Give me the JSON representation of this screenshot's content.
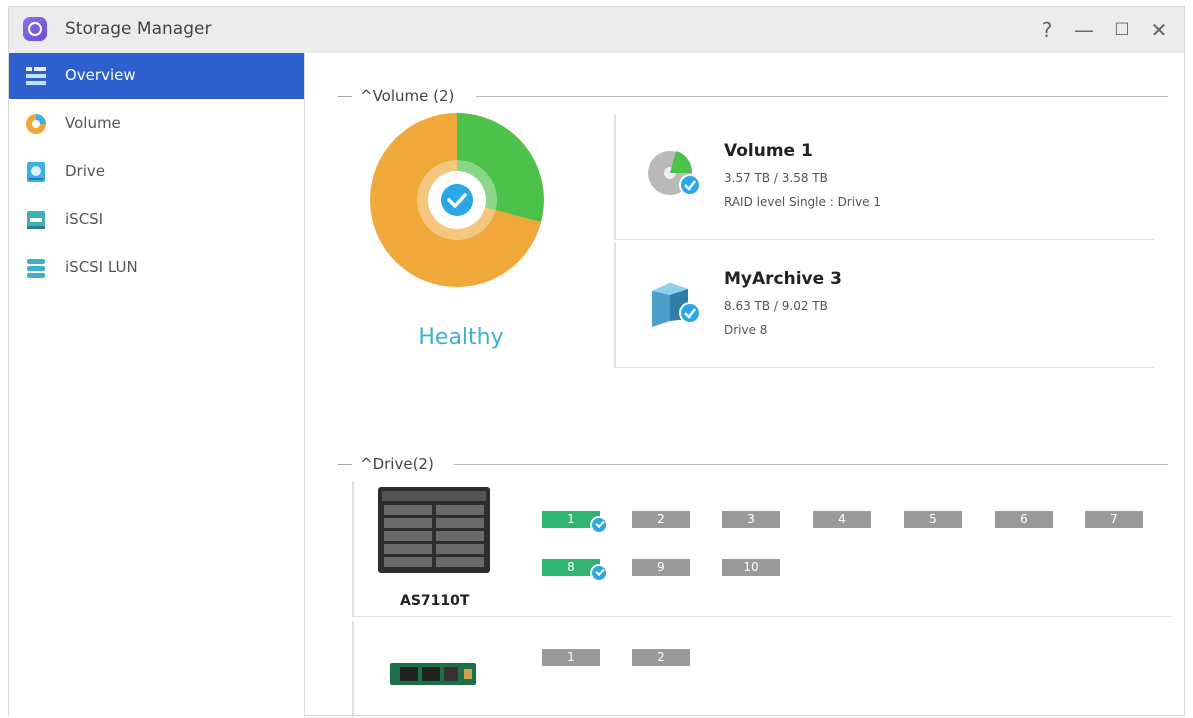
{
  "app": {
    "title": "Storage Manager"
  },
  "window_controls": {
    "help": "?",
    "minimize": "—",
    "maximize": "☐",
    "close": "✕"
  },
  "sidebar": {
    "items": [
      {
        "label": "Overview",
        "icon": "overview-icon",
        "active": true
      },
      {
        "label": "Volume",
        "icon": "volume-icon",
        "active": false
      },
      {
        "label": "Drive",
        "icon": "drive-icon",
        "active": false
      },
      {
        "label": "iSCSI",
        "icon": "iscsi-icon",
        "active": false
      },
      {
        "label": "iSCSI LUN",
        "icon": "iscsi-lun-icon",
        "active": false
      }
    ]
  },
  "volume_section": {
    "heading": "Volume (2)",
    "status": "Healthy",
    "chart_colors": {
      "used": "#f0a83a",
      "free": "#4cc24a"
    },
    "volumes": [
      {
        "name": "Volume 1",
        "size": "3.57 TB / 3.58 TB",
        "detail": "RAID level Single : Drive 1"
      },
      {
        "name": "MyArchive 3",
        "size": "8.63 TB / 9.02 TB",
        "detail": "Drive 8"
      }
    ]
  },
  "drive_section": {
    "heading": "Drive(2)",
    "nas": {
      "model": "AS7110T",
      "bays": [
        {
          "label": "1",
          "ok": true
        },
        {
          "label": "2",
          "ok": false
        },
        {
          "label": "3",
          "ok": false
        },
        {
          "label": "4",
          "ok": false
        },
        {
          "label": "5",
          "ok": false
        },
        {
          "label": "6",
          "ok": false
        },
        {
          "label": "7",
          "ok": false
        },
        {
          "label": "8",
          "ok": true
        },
        {
          "label": "9",
          "ok": false
        },
        {
          "label": "10",
          "ok": false
        }
      ]
    },
    "m2": {
      "bays": [
        {
          "label": "1"
        },
        {
          "label": "2"
        }
      ]
    }
  }
}
